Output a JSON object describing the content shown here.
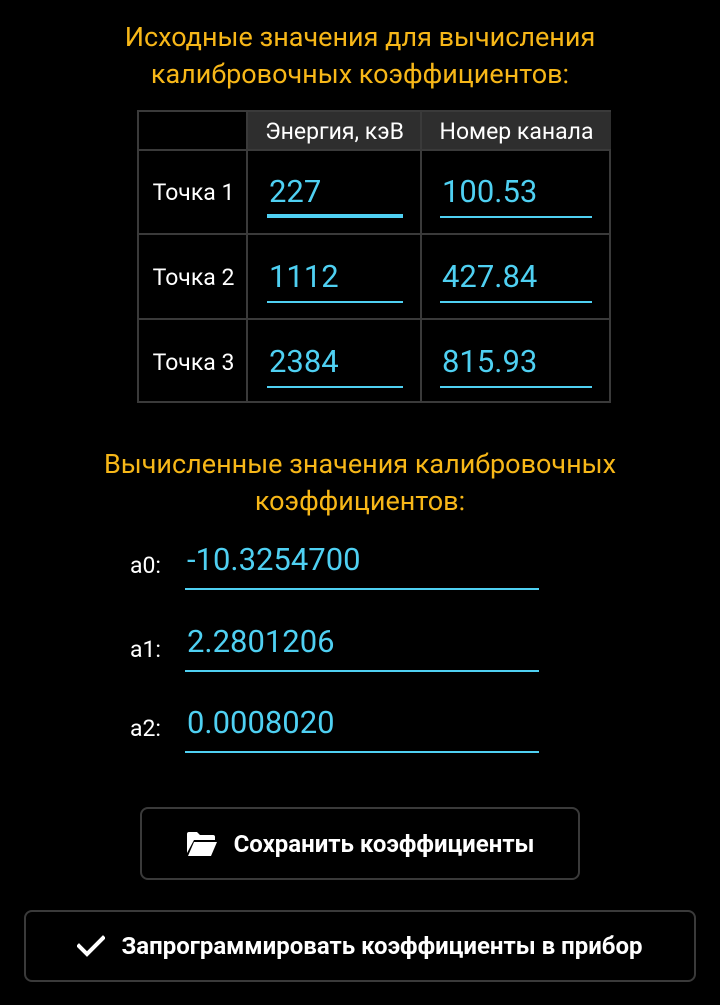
{
  "input_section": {
    "heading_line1": "Исходные значения для вычисления",
    "heading_line2": "калибровочных коэффициентов:"
  },
  "table": {
    "columns": [
      "Энергия, кэВ",
      "Номер канала"
    ],
    "rows": [
      {
        "label": "Точка 1",
        "energy": "227",
        "channel": "100.53"
      },
      {
        "label": "Точка 2",
        "energy": "1112",
        "channel": "427.84"
      },
      {
        "label": "Точка 3",
        "energy": "2384",
        "channel": "815.93"
      }
    ]
  },
  "computed_section": {
    "heading_line1": "Вычисленные значения калибровочных",
    "heading_line2": "коэффициентов:",
    "coefficients": [
      {
        "label": "a0:",
        "value": "-10.3254700"
      },
      {
        "label": "a1:",
        "value": "2.2801206"
      },
      {
        "label": "a2:",
        "value": "0.0008020"
      }
    ]
  },
  "buttons": {
    "save_label": "Сохранить коэффициенты",
    "save_icon": "folder-open-icon",
    "program_label": "Запрограммировать коэффициенты в прибор",
    "program_icon": "checkmark-icon"
  },
  "colors": {
    "heading": "#f7b718",
    "field_value": "#4fd0f2",
    "background": "#000000",
    "border": "#3a3a3a"
  }
}
